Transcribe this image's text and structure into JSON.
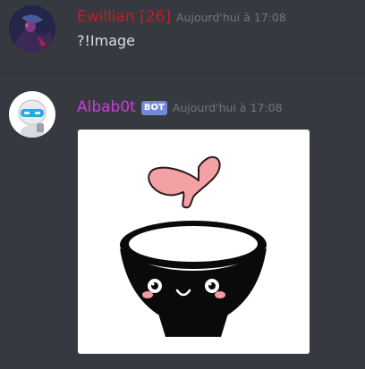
{
  "messages": [
    {
      "username": "Ewillian [26]",
      "username_color": "#c81e1e",
      "timestamp": "Aujourd'hui à 17:08",
      "content": "?!Image"
    },
    {
      "username": "Albab0t",
      "username_color": "#c93ddb",
      "bot_tag": "BOT",
      "timestamp": "Aujourd'hui à 17:08",
      "attachment_icon": "heart-bowl-image"
    }
  ],
  "colors": {
    "background": "#36393f",
    "timestamp": "#72767d",
    "text": "#dcddde",
    "bot_tag": "#7289da"
  }
}
